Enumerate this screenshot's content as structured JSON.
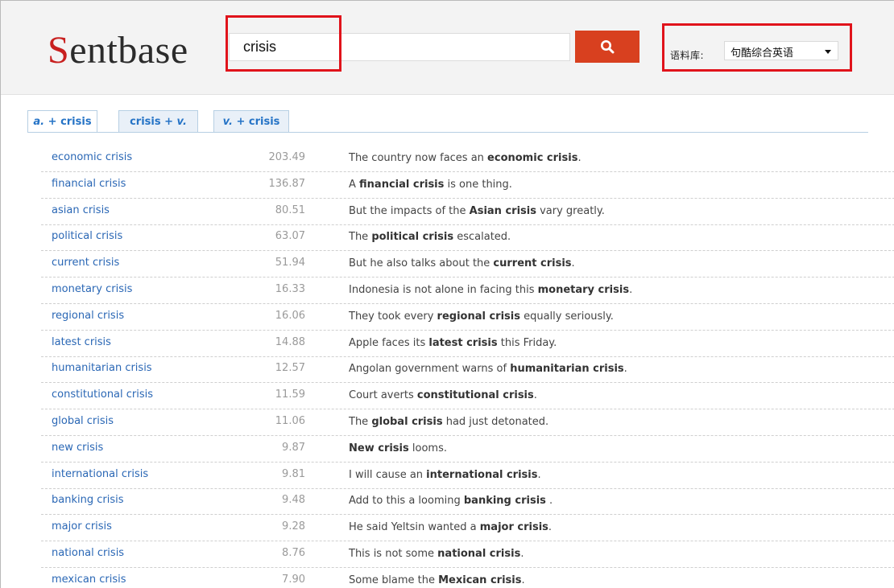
{
  "brand": {
    "first_letter": "S",
    "rest": "entbase"
  },
  "search": {
    "value": "crisis"
  },
  "corpus": {
    "label": "语料库:",
    "selected": "句酷综合英语"
  },
  "colors": {
    "accent": "#d8401f",
    "link": "#2a67b5",
    "highlight_box": "#e0131b"
  },
  "icons": {
    "search_button": "search-icon",
    "dropdown": "chevron-down-icon"
  },
  "tabs": [
    {
      "pre_it": "a.",
      "text": " + crisis",
      "post_it": ""
    },
    {
      "pre_text": "crisis + ",
      "post_it": "v."
    },
    {
      "pre_it": "v.",
      "text": " + crisis",
      "post_it": ""
    }
  ],
  "rows": [
    {
      "phrase": "economic crisis",
      "score": "203.49",
      "before": "The country now faces an ",
      "bold": "economic crisis",
      "after": "."
    },
    {
      "phrase": "financial crisis",
      "score": "136.87",
      "before": "A ",
      "bold": "financial crisis",
      "after": " is one thing."
    },
    {
      "phrase": "asian crisis",
      "score": "80.51",
      "before": "But the impacts of the ",
      "bold": "Asian crisis",
      "after": " vary greatly."
    },
    {
      "phrase": "political crisis",
      "score": "63.07",
      "before": "The ",
      "bold": "political crisis",
      "after": " escalated."
    },
    {
      "phrase": "current crisis",
      "score": "51.94",
      "before": "But he also talks about the ",
      "bold": "current crisis",
      "after": "."
    },
    {
      "phrase": "monetary crisis",
      "score": "16.33",
      "before": "Indonesia is not alone in facing this ",
      "bold": "monetary crisis",
      "after": "."
    },
    {
      "phrase": "regional crisis",
      "score": "16.06",
      "before": "They took every ",
      "bold": "regional crisis",
      "after": " equally seriously."
    },
    {
      "phrase": "latest crisis",
      "score": "14.88",
      "before": "Apple faces its ",
      "bold": "latest crisis",
      "after": " this Friday."
    },
    {
      "phrase": "humanitarian crisis",
      "score": "12.57",
      "before": "Angolan government warns of ",
      "bold": "humanitarian crisis",
      "after": "."
    },
    {
      "phrase": "constitutional crisis",
      "score": "11.59",
      "before": "Court averts ",
      "bold": "constitutional crisis",
      "after": "."
    },
    {
      "phrase": "global crisis",
      "score": "11.06",
      "before": "The ",
      "bold": "global crisis",
      "after": " had just detonated."
    },
    {
      "phrase": "new crisis",
      "score": "9.87",
      "before": "",
      "bold": "New crisis",
      "after": " looms."
    },
    {
      "phrase": "international crisis",
      "score": "9.81",
      "before": "I will cause an ",
      "bold": "international crisis",
      "after": "."
    },
    {
      "phrase": "banking crisis",
      "score": "9.48",
      "before": "Add to this a looming ",
      "bold": "banking crisis",
      "after": " ."
    },
    {
      "phrase": "major crisis",
      "score": "9.28",
      "before": "He said Yeltsin wanted a ",
      "bold": "major crisis",
      "after": "."
    },
    {
      "phrase": "national crisis",
      "score": "8.76",
      "before": "This is not some ",
      "bold": "national crisis",
      "after": "."
    },
    {
      "phrase": "mexican crisis",
      "score": "7.90",
      "before": "Some blame the ",
      "bold": "Mexican crisis",
      "after": "."
    }
  ]
}
